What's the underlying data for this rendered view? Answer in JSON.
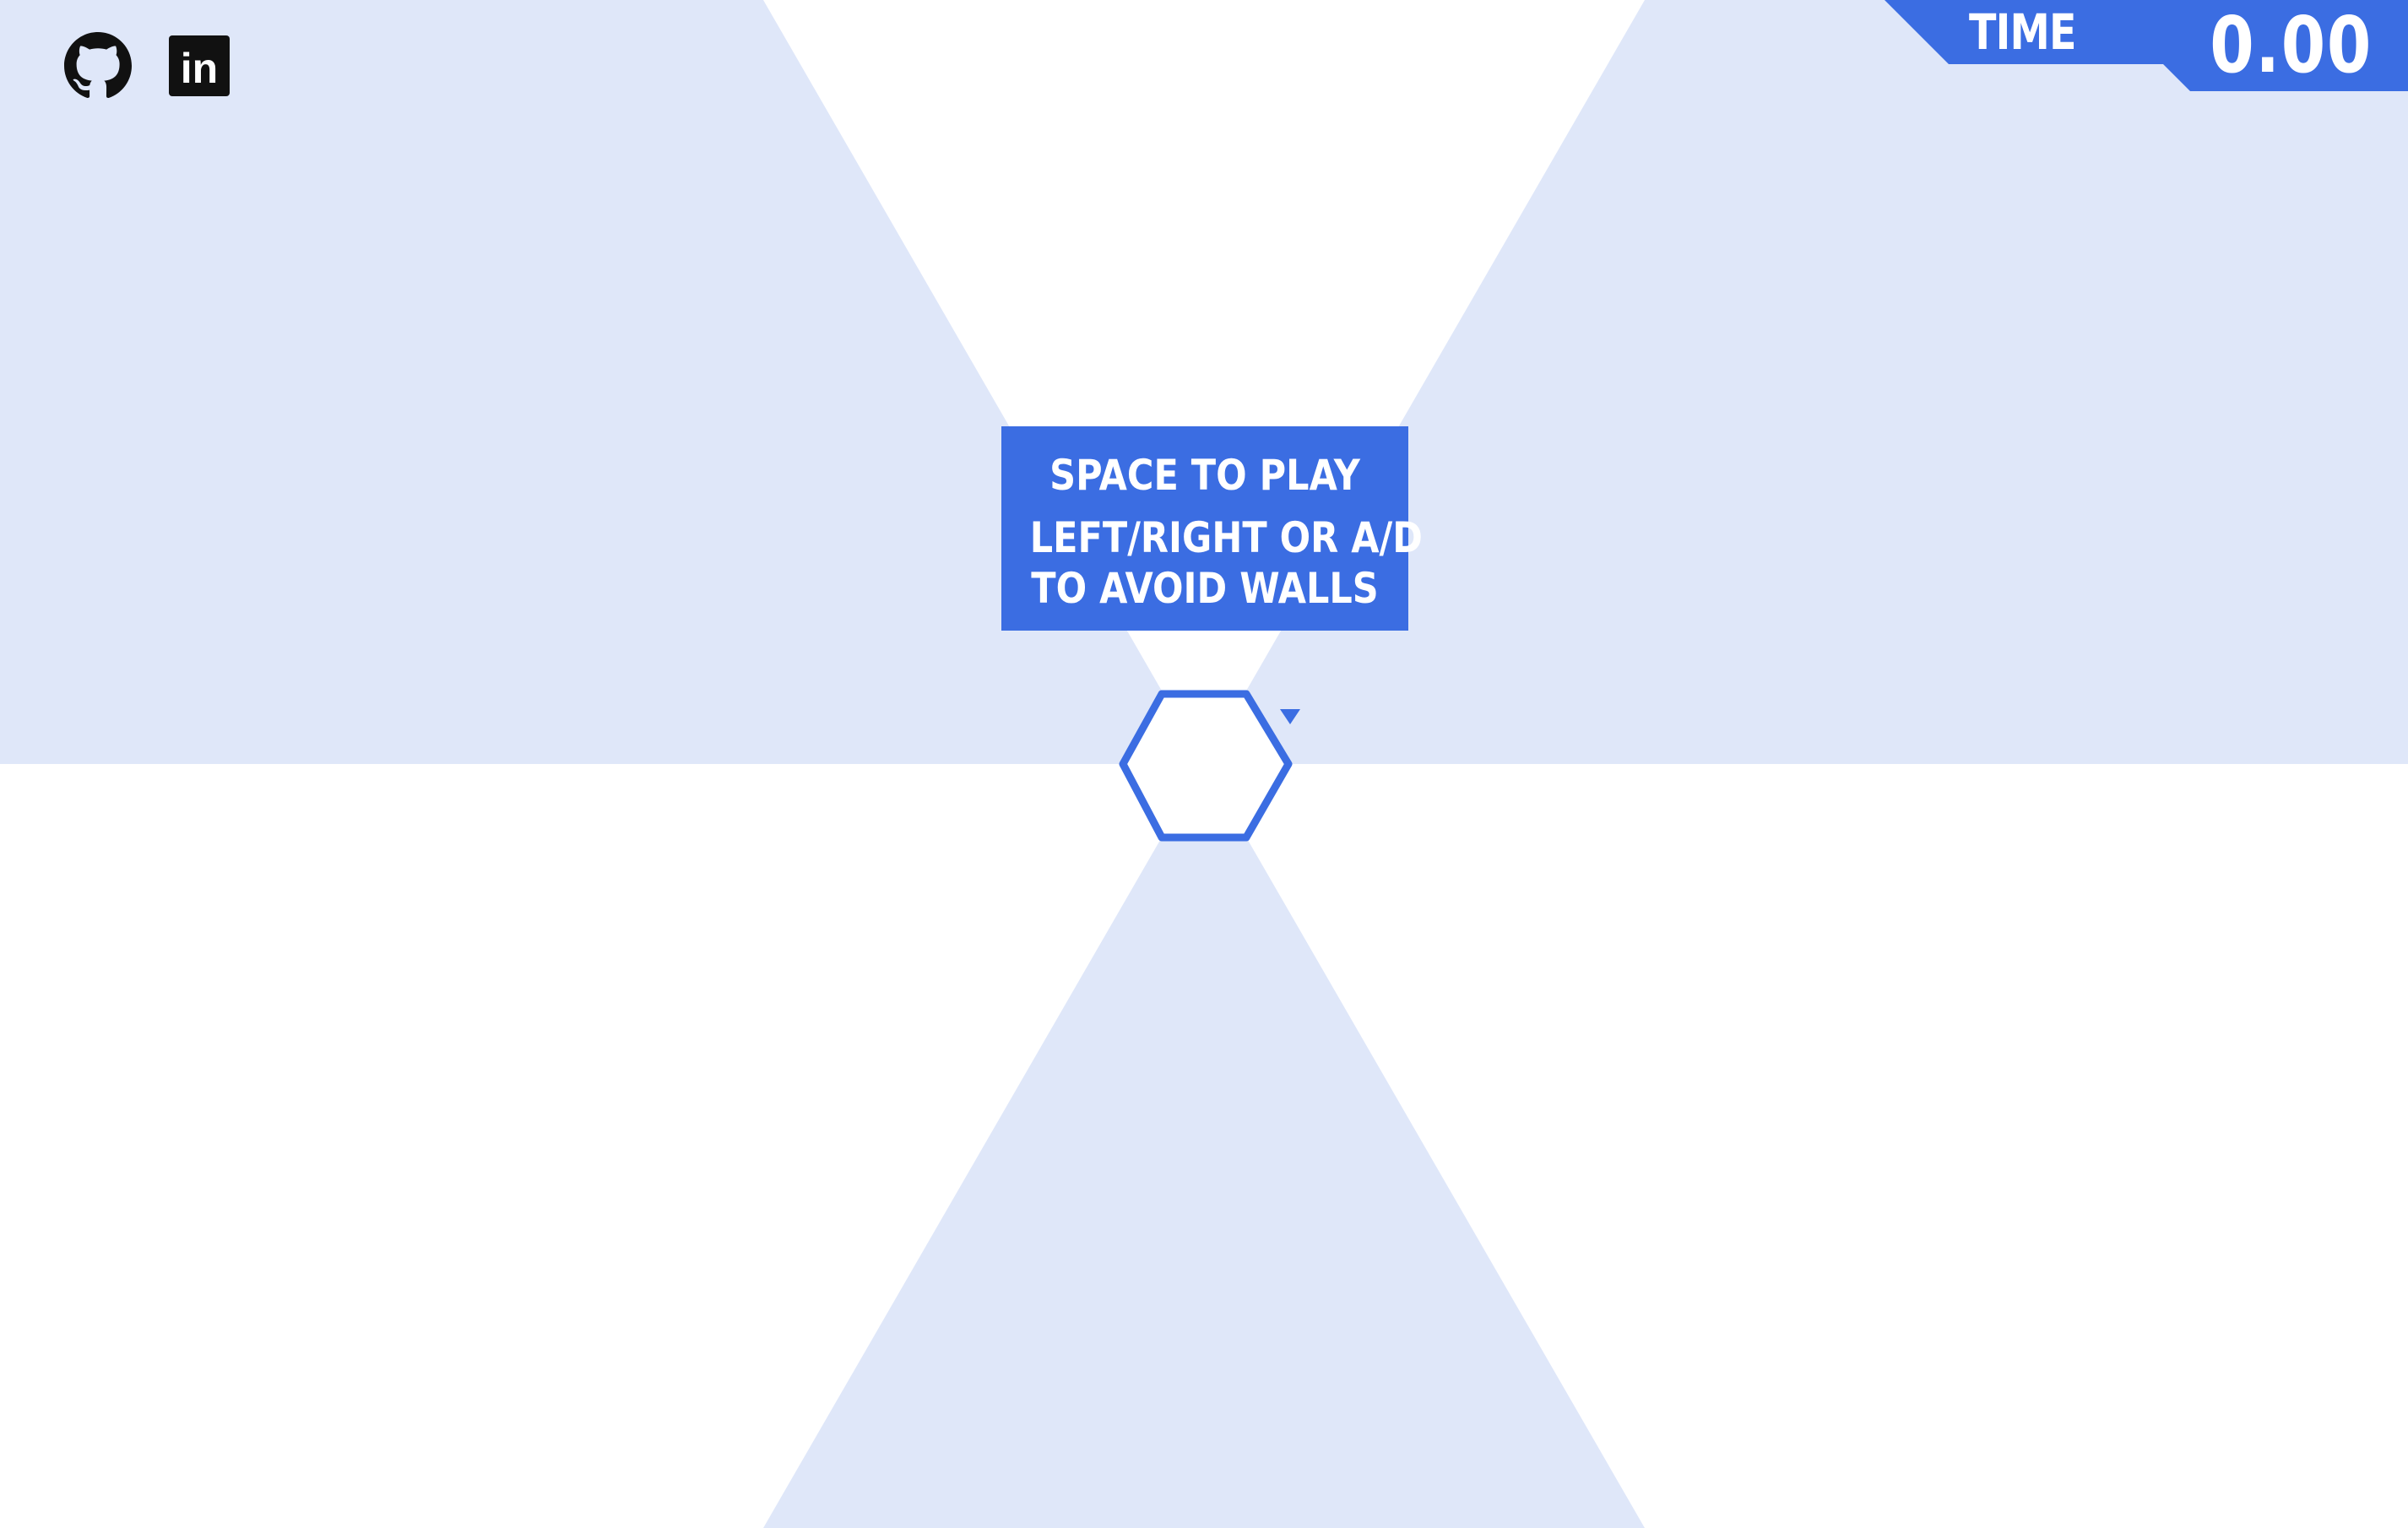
{
  "colors": {
    "background": "#ffffff",
    "sector": "#dfe7f9",
    "accent": "#3b6de2",
    "text_on_accent": "#ffffff",
    "social_icon": "#111111"
  },
  "social": {
    "links": [
      {
        "icon": "github-icon"
      },
      {
        "icon": "linkedin-icon",
        "glyph": "in"
      }
    ]
  },
  "hud": {
    "time_label": "TIME",
    "time_value": "0.00"
  },
  "overlay": {
    "play_prompt": "SPACE TO PLAY",
    "controls_line_1": "LEFT/RIGHT OR A/D",
    "controls_line_2": "TO AVOID WALLS"
  },
  "game": {
    "shaded_sectors": [
      "upper-left",
      "upper-right",
      "bottom"
    ],
    "center_shape": "hexagon",
    "player_marker": "triangle-cursor"
  }
}
